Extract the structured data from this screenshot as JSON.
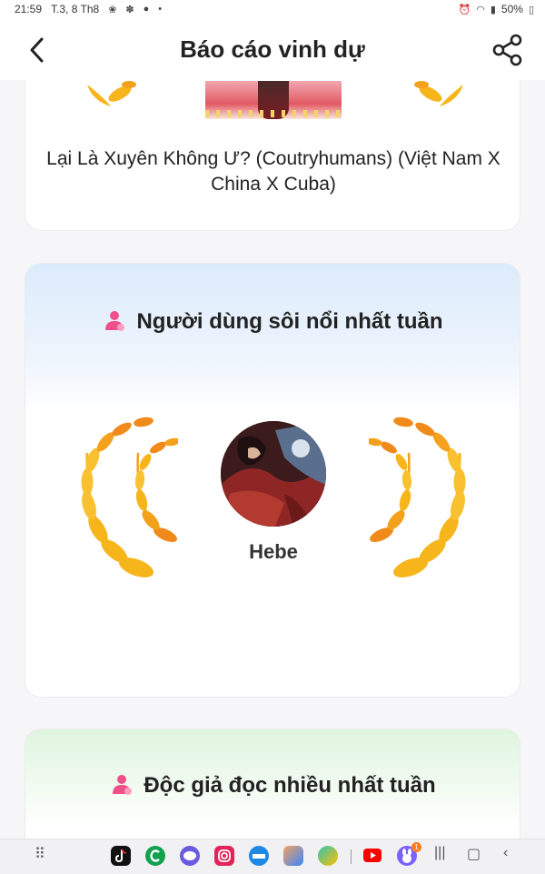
{
  "status_bar": {
    "time": "21:59",
    "date": "T.3, 8 Th8",
    "battery": "50%",
    "notification_icons": [
      "leaf-icon",
      "bug-icon",
      "chat-icon",
      "dot-icon"
    ],
    "system_icons": [
      "alarm-icon",
      "wifi-icon",
      "signal-icon",
      "battery-icon"
    ]
  },
  "header": {
    "title": "Báo cáo vinh dự",
    "back_icon": "back-arrow-icon",
    "share_icon": "share-icon"
  },
  "top_card": {
    "book_title": "Lại Là Xuyên Không Ư? (Coutryhumans) (Việt Nam X China X Cuba)"
  },
  "active_user_section": {
    "title": "Người dùng sôi nổi nhất tuần",
    "icon": "user-icon",
    "username": "Hebe"
  },
  "reader_section": {
    "title": "Độc giả đọc nhiều nhất tuần",
    "icon": "user-icon"
  },
  "nav_bar": {
    "apps": [
      "apps-grid-icon",
      "tiktok-icon",
      "c-app-icon",
      "messages-icon",
      "instagram-icon",
      "epic-icon",
      "game-icon",
      "browser-icon",
      "youtube-icon",
      "bunny-app-icon"
    ],
    "badge": "1",
    "system": [
      "recents-icon",
      "home-icon",
      "back-icon"
    ]
  },
  "colors": {
    "laurel_gold": "#f7b51c",
    "laurel_orange": "#f08a1a",
    "user_icon_pink": "#f04f8a",
    "active_header_blue": "#dcebfb",
    "reader_header_green": "#dff5df"
  }
}
